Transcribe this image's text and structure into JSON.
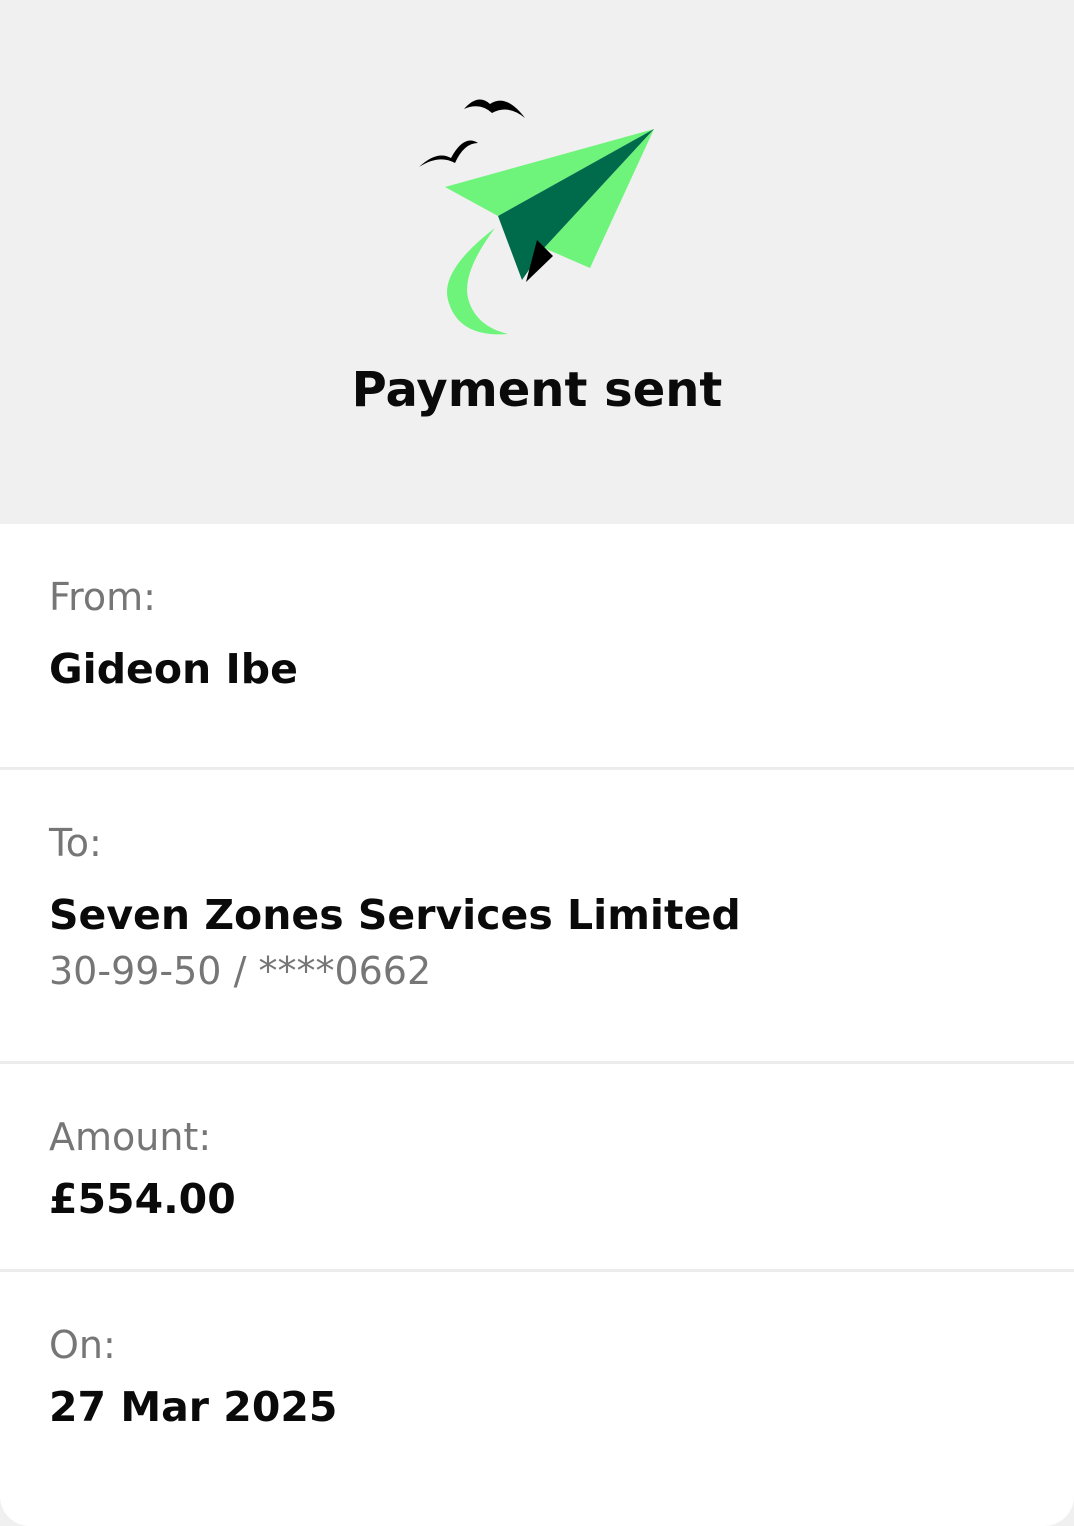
{
  "header": {
    "icon": "paper-plane-icon",
    "title": "Payment sent"
  },
  "details": {
    "from": {
      "label": "From:",
      "value": "Gideon Ibe"
    },
    "to": {
      "label": "To:",
      "value": "Seven Zones Services Limited",
      "account": "30-99-50 / ****0662"
    },
    "amount": {
      "label": "Amount:",
      "value": "£554.00"
    },
    "on": {
      "label": "On:",
      "value": "27 Mar 2025"
    }
  },
  "colors": {
    "accent_light_green": "#6ef47a",
    "accent_dark_green": "#006b4a",
    "header_background": "#f0f0f0"
  }
}
